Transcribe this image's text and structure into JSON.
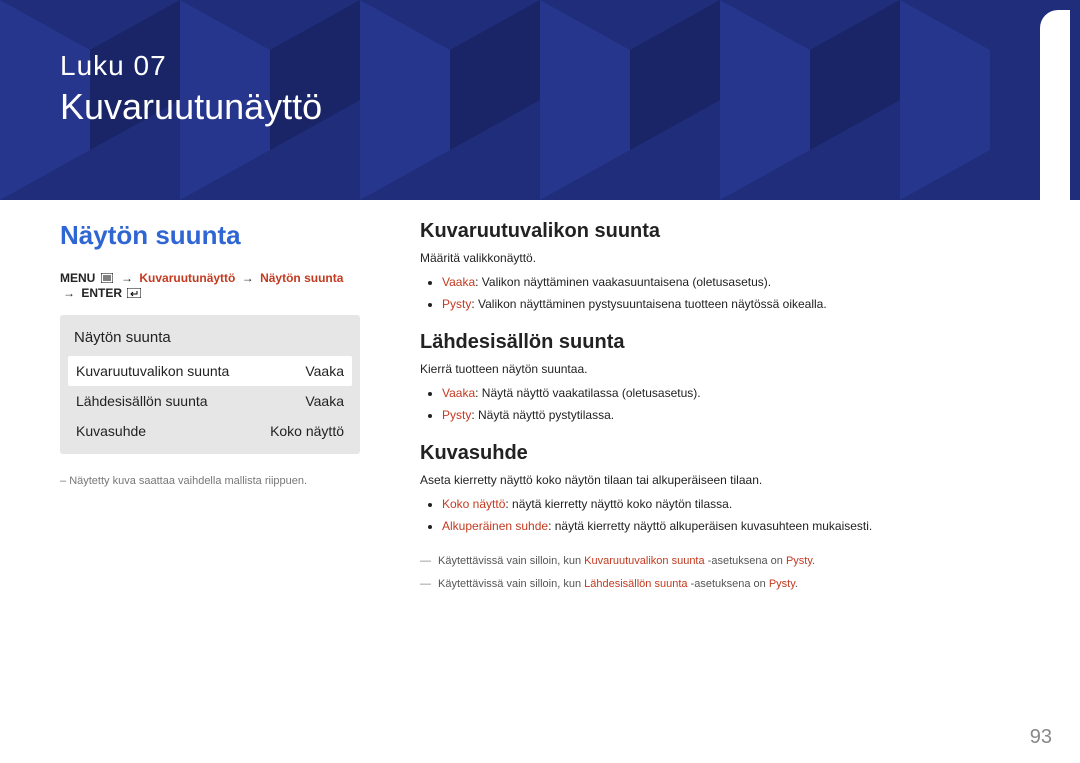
{
  "banner": {
    "chapter_label": "Luku  07",
    "chapter_title": "Kuvaruutunäyttö"
  },
  "left": {
    "section_title": "Näytön suunta",
    "breadcrumb": {
      "menu": "MENU",
      "seg1": "Kuvaruutunäyttö",
      "seg2": "Näytön suunta",
      "enter": "ENTER"
    },
    "menu_preview": {
      "title": "Näytön suunta",
      "rows": [
        {
          "label": "Kuvaruutuvalikon suunta",
          "value": "Vaaka",
          "selected": true
        },
        {
          "label": "Lähdesisällön suunta",
          "value": "Vaaka",
          "selected": false
        },
        {
          "label": "Kuvasuhde",
          "value": "Koko näyttö",
          "selected": false
        }
      ]
    },
    "footnote": "Näytetty kuva saattaa vaihdella mallista riippuen."
  },
  "right": {
    "sections": [
      {
        "heading": "Kuvaruutuvalikon suunta",
        "desc": "Määritä valikkonäyttö.",
        "bullets": [
          {
            "opt": "Vaaka",
            "text": ": Valikon näyttäminen vaakasuuntaisena (oletusasetus)."
          },
          {
            "opt": "Pysty",
            "text": ": Valikon näyttäminen pystysuuntaisena tuotteen näytössä oikealla."
          }
        ]
      },
      {
        "heading": "Lähdesisällön suunta",
        "desc": "Kierrä tuotteen näytön suuntaa.",
        "bullets": [
          {
            "opt": "Vaaka",
            "text": ": Näytä näyttö vaakatilassa (oletusasetus)."
          },
          {
            "opt": "Pysty",
            "text": ": Näytä näyttö pystytilassa."
          }
        ]
      },
      {
        "heading": "Kuvasuhde",
        "desc": "Aseta kierretty näyttö koko näytön tilaan tai alkuperäiseen tilaan.",
        "bullets": [
          {
            "opt": "Koko näyttö",
            "text": ": näytä kierretty näyttö koko näytön tilassa."
          },
          {
            "opt": "Alkuperäinen suhde",
            "text": ": näytä kierretty näyttö alkuperäisen kuvasuhteen mukaisesti."
          }
        ],
        "notes": [
          {
            "pre": "Käytettävissä vain silloin, kun ",
            "hl1": "Kuvaruutuvalikon suunta",
            "mid": " -asetuksena on ",
            "hl2": "Pysty",
            "post": "."
          },
          {
            "pre": "Käytettävissä vain silloin, kun ",
            "hl1": "Lähdesisällön suunta",
            "mid": " -asetuksena on ",
            "hl2": "Pysty",
            "post": "."
          }
        ]
      }
    ]
  },
  "page_number": "93"
}
